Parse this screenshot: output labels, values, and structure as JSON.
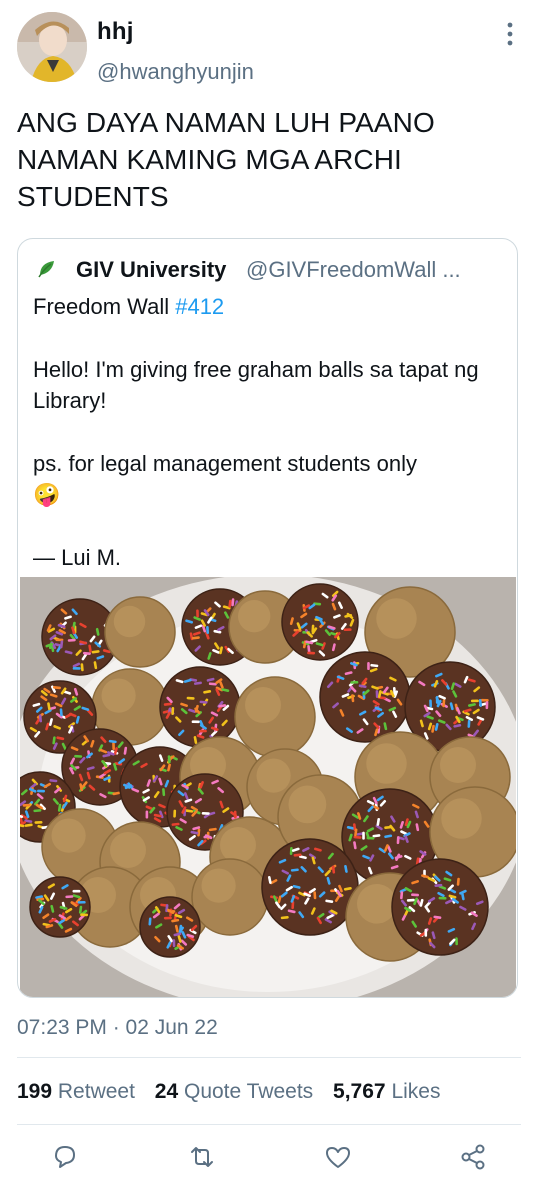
{
  "tweet": {
    "display_name": "hhj",
    "handle": "@hwanghyunjin",
    "text": "ANG DAYA NAMAN LUH PAANO NAMAN KAMING MGA ARCHI STUDENTS",
    "timestamp": "07:23 PM · 02 Jun 22"
  },
  "quote": {
    "name": "GIV University",
    "handle": "@GIVFreedomWall ...",
    "line1_prefix": "Freedom Wall ",
    "hashtag": "#412",
    "para2": "Hello! I'm giving free graham balls sa tapat ng Library!",
    "para3": "ps. for legal management students only",
    "emoji": "🤪",
    "signature": "— Lui M."
  },
  "stats": {
    "retweet_count": "199",
    "retweet_label": "Retweet",
    "quote_count": "24",
    "quote_label": "Quote Tweets",
    "likes_count": "5,767",
    "likes_label": "Likes"
  },
  "icons": {
    "more": "more-vertical-icon",
    "leaf": "leaf-icon",
    "reply": "reply-icon",
    "retweet": "retweet-icon",
    "like": "heart-icon",
    "share": "share-icon"
  },
  "colors": {
    "text": "#0f1419",
    "secondary": "#5b7083",
    "link": "#1d9bf0",
    "border": "#cfd9de",
    "leaf": "#3a9a3a"
  }
}
